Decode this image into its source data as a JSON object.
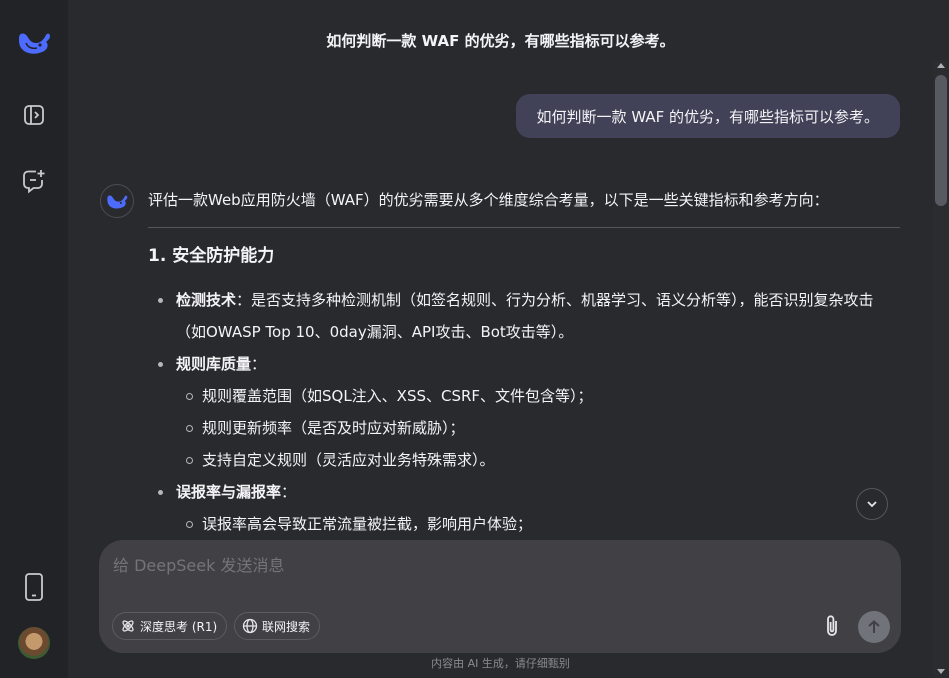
{
  "app": {
    "accent": "#4d6bfe"
  },
  "sidebar": {
    "logo_icon": "deepseek-whale-icon",
    "toggle_icon": "sidebar-open-icon",
    "new_chat_icon": "new-chat-icon",
    "phone_icon": "mobile-phone-icon"
  },
  "header": {
    "title": "如何判断一款 WAF 的优劣，有哪些指标可以参考。"
  },
  "conversation": {
    "user_message": "如何判断一款 WAF 的优劣，有哪些指标可以参考。",
    "answer": {
      "intro": "评估一款Web应用防火墙（WAF）的优劣需要从多个维度综合考量，以下是一些关键指标和参考方向：",
      "section_title": "1. 安全防护能力",
      "item1_label": "检测技术",
      "item1_text": "：是否支持多种检测机制（如签名规则、行为分析、机器学习、语义分析等），能否识别复杂攻击（如OWASP Top 10、0day漏洞、API攻击、Bot攻击等）。",
      "item2_label": "规则库质量",
      "item2_colon": "：",
      "item2_subs": [
        "规则覆盖范围（如SQL注入、XSS、CSRF、文件包含等）；",
        "规则更新频率（是否及时应对新威胁）；",
        "支持自定义规则（灵活应对业务特殊需求）。"
      ],
      "item3_label": "误报率与漏报率",
      "item3_colon": "：",
      "item3_subs": [
        "误报率高会导致正常流量被拦截，影响用户体验；"
      ]
    }
  },
  "composer": {
    "placeholder": "给 DeepSeek 发送消息",
    "deep_think_label": "深度思考 (R1)",
    "web_search_label": "联网搜索"
  },
  "footer_note": "内容由 AI 生成，请仔细甄别"
}
